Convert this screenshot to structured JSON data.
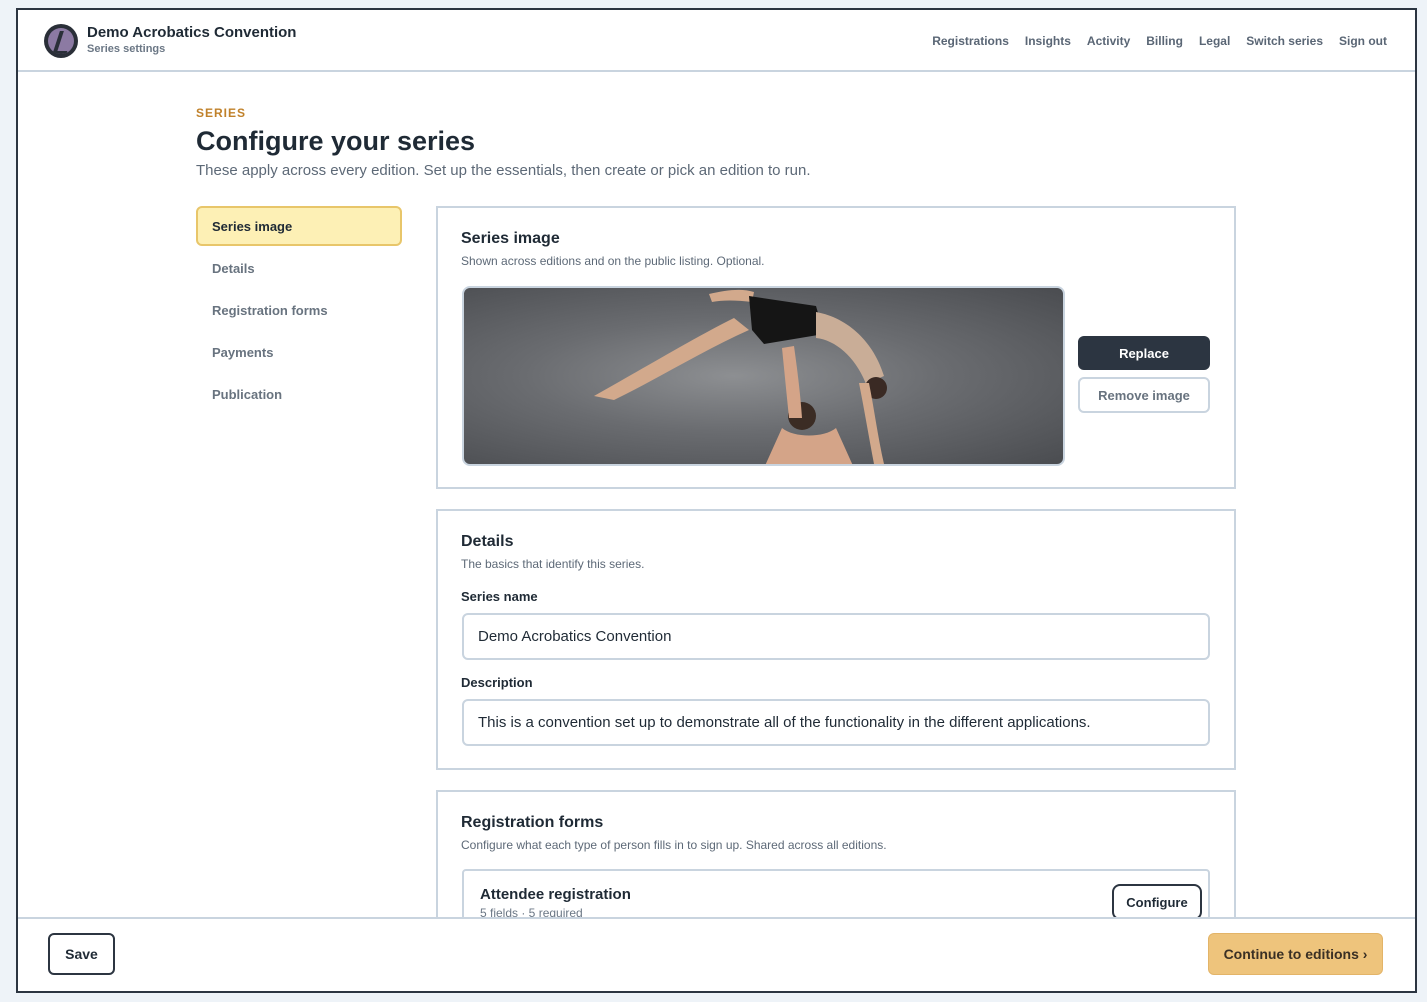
{
  "header": {
    "app_title": "Demo Acrobatics Convention",
    "app_subtitle": "Series settings",
    "nav": [
      "Registrations",
      "Insights",
      "Activity",
      "Billing",
      "Legal",
      "Switch series",
      "Sign out"
    ]
  },
  "page": {
    "eyebrow": "SERIES",
    "title": "Configure your series",
    "subtitle": "These apply across every edition. Set up the essentials, then create or pick an edition to run."
  },
  "sidenav": {
    "items": [
      "Series image",
      "Details",
      "Registration forms",
      "Payments",
      "Publication"
    ],
    "active": "Series image"
  },
  "series_image": {
    "title": "Series image",
    "description": "Shown across editions and on the public listing. Optional.",
    "replace_label": "Replace",
    "remove_label": "Remove image"
  },
  "details": {
    "title": "Details",
    "description": "The basics that identify this series.",
    "name_label": "Series name",
    "name_value": "Demo Acrobatics Convention",
    "description_label": "Description",
    "description_value": "This is a convention set up to demonstrate all of the functionality in the different applications."
  },
  "registration_forms": {
    "title": "Registration forms",
    "description": "Configure what each type of person fills in to sign up. Shared across all editions.",
    "forms": [
      {
        "name": "Attendee registration",
        "meta": "5 fields · 5 required",
        "action_label": "Configure"
      }
    ]
  },
  "footer": {
    "save_label": "Save",
    "continue_label": "Continue to editions ›"
  },
  "colors": {
    "accent": "#c0812a",
    "active_nav_bg": "#fdf0b5",
    "primary_dark": "#2c3541",
    "continue_bg": "#eec47c"
  }
}
